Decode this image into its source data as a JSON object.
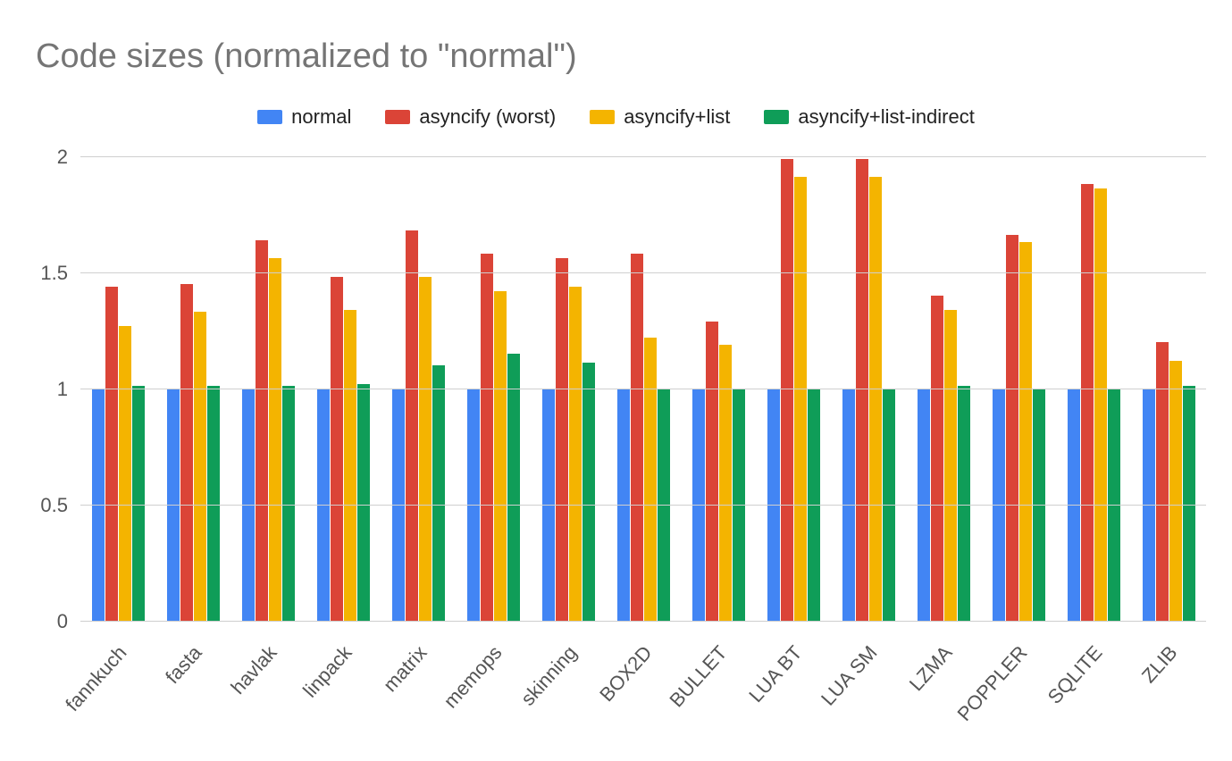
{
  "chart_data": {
    "type": "bar",
    "title": "Code sizes (normalized to \"normal\")",
    "xlabel": "",
    "ylabel": "",
    "ylim": [
      0,
      2
    ],
    "yticks": [
      0,
      0.5,
      1,
      1.5,
      2
    ],
    "categories": [
      "fannkuch",
      "fasta",
      "havlak",
      "linpack",
      "matrix",
      "memops",
      "skinning",
      "BOX2D",
      "BULLET",
      "LUA BT",
      "LUA SM",
      "LZMA",
      "POPPLER",
      "SQLITE",
      "ZLIB"
    ],
    "series": [
      {
        "name": "normal",
        "color": "#4285F4",
        "values": [
          1.0,
          1.0,
          1.0,
          1.0,
          1.0,
          1.0,
          1.0,
          1.0,
          1.0,
          1.0,
          1.0,
          1.0,
          1.0,
          1.0,
          1.0
        ]
      },
      {
        "name": "asyncify (worst)",
        "color": "#DB4437",
        "values": [
          1.44,
          1.45,
          1.64,
          1.48,
          1.68,
          1.58,
          1.56,
          1.58,
          1.29,
          1.99,
          1.99,
          1.4,
          1.66,
          1.88,
          1.2
        ]
      },
      {
        "name": "asyncify+list",
        "color": "#F4B400",
        "values": [
          1.27,
          1.33,
          1.56,
          1.34,
          1.48,
          1.42,
          1.44,
          1.22,
          1.19,
          1.91,
          1.91,
          1.34,
          1.63,
          1.86,
          1.12
        ]
      },
      {
        "name": "asyncify+list-indirect",
        "color": "#0F9D58",
        "values": [
          1.01,
          1.01,
          1.01,
          1.02,
          1.1,
          1.15,
          1.11,
          1.0,
          1.0,
          1.0,
          1.0,
          1.01,
          1.0,
          1.0,
          1.01
        ]
      }
    ],
    "legend_position": "top"
  }
}
